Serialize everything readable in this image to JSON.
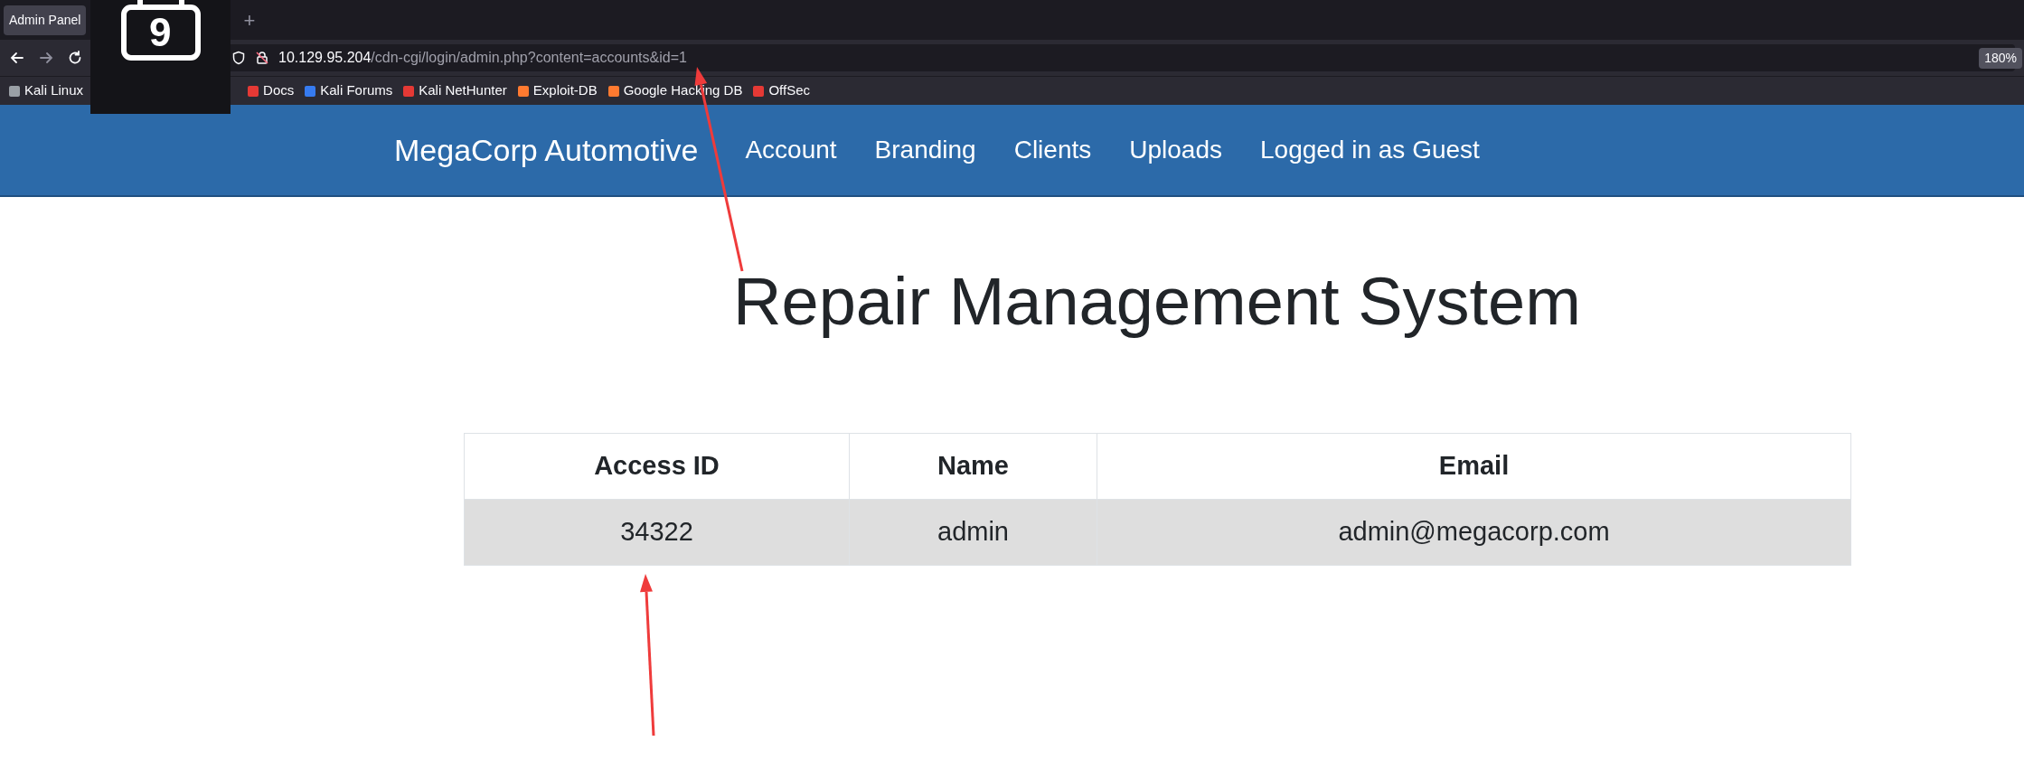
{
  "browser": {
    "tab": {
      "title": "Admin Panel",
      "selected": true
    },
    "new_tab": "+",
    "url": {
      "host": "10.129.95.204",
      "path": "/cdn-cgi/login/admin.php?content=accounts&id=1"
    },
    "zoom": "180%",
    "bookmarks": [
      {
        "label": "Kali Linux"
      },
      {
        "label": "Docs"
      },
      {
        "label": "Kali Forums"
      },
      {
        "label": "Kali NetHunter"
      },
      {
        "label": "Exploit-DB"
      },
      {
        "label": "Google Hacking DB"
      },
      {
        "label": "OffSec"
      }
    ]
  },
  "overlay": {
    "digit": "9"
  },
  "navbar": {
    "brand": "MegaCorp Automotive",
    "links": [
      "Account",
      "Branding",
      "Clients",
      "Uploads",
      "Logged in as Guest"
    ]
  },
  "page": {
    "title": "Repair Management System"
  },
  "table": {
    "columns": [
      "Access ID",
      "Name",
      "Email"
    ],
    "rows": [
      [
        "34322",
        "admin",
        "admin@megacorp.com"
      ]
    ]
  }
}
